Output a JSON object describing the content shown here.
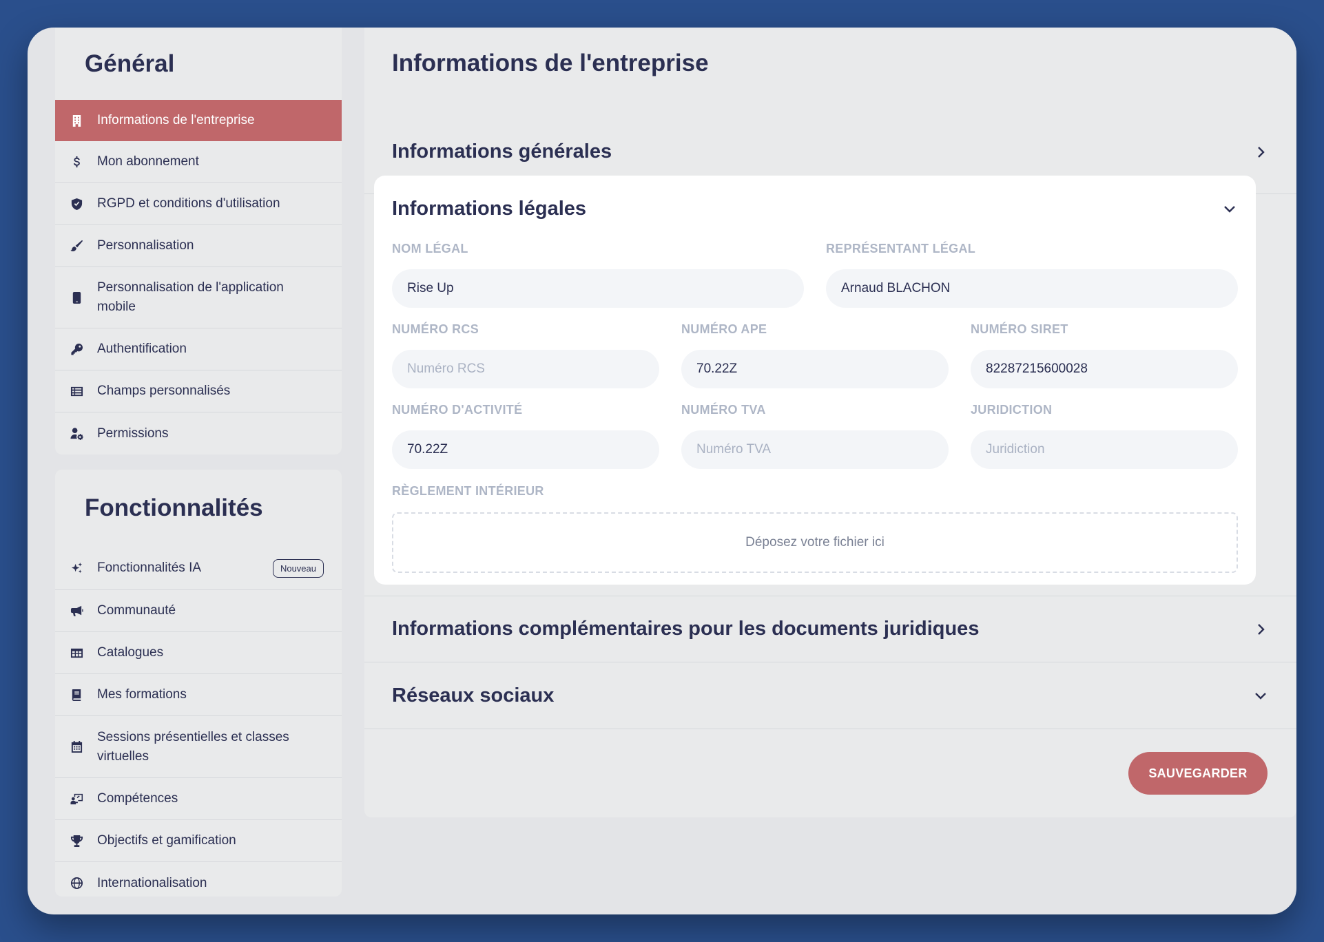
{
  "sidebar": {
    "general": {
      "title": "Général",
      "items": [
        {
          "label": "Informations de l'entreprise",
          "icon": "building-icon"
        },
        {
          "label": "Mon abonnement",
          "icon": "dollar-icon"
        },
        {
          "label": "RGPD et conditions d'utilisation",
          "icon": "shield-icon"
        },
        {
          "label": "Personnalisation",
          "icon": "brush-icon"
        },
        {
          "label": "Personnalisation de l'application mobile",
          "icon": "mobile-icon"
        },
        {
          "label": "Authentification",
          "icon": "key-icon"
        },
        {
          "label": "Champs personnalisés",
          "icon": "list-table-icon"
        },
        {
          "label": "Permissions",
          "icon": "user-gear-icon"
        }
      ]
    },
    "features": {
      "title": "Fonctionnalités",
      "items": [
        {
          "label": "Fonctionnalités IA",
          "icon": "sparkles-icon",
          "badge": "Nouveau"
        },
        {
          "label": "Communauté",
          "icon": "megaphone-icon"
        },
        {
          "label": "Catalogues",
          "icon": "grid-table-icon"
        },
        {
          "label": "Mes formations",
          "icon": "book-icon"
        },
        {
          "label": "Sessions présentielles et classes virtuelles",
          "icon": "calendar-icon"
        },
        {
          "label": "Compétences",
          "icon": "chalkboard-user-icon"
        },
        {
          "label": "Objectifs et gamification",
          "icon": "trophy-icon"
        },
        {
          "label": "Internationalisation",
          "icon": "globe-icon"
        }
      ]
    }
  },
  "main": {
    "title": "Informations de l'entreprise",
    "sections": {
      "general": "Informations générales",
      "legal": "Informations légales",
      "complementary": "Informations complémentaires pour les documents juridiques",
      "social": "Réseaux sociaux"
    },
    "legal_form": {
      "nom_legal": {
        "label": "NOM LÉGAL",
        "value": "Rise Up",
        "placeholder": "Nom légal"
      },
      "representant": {
        "label": "REPRÉSENTANT LÉGAL",
        "value": "Arnaud BLACHON",
        "placeholder": "Représentant légal"
      },
      "rcs": {
        "label": "NUMÉRO RCS",
        "value": "",
        "placeholder": "Numéro RCS"
      },
      "ape": {
        "label": "NUMÉRO APE",
        "value": "70.22Z",
        "placeholder": "Numéro APE"
      },
      "siret": {
        "label": "NUMÉRO SIRET",
        "value": "82287215600028",
        "placeholder": "Numéro SIRET"
      },
      "activite": {
        "label": "NUMÉRO D'ACTIVITÉ",
        "value": "70.22Z",
        "placeholder": "Numéro d'activité"
      },
      "tva": {
        "label": "NUMÉRO TVA",
        "value": "",
        "placeholder": "Numéro TVA"
      },
      "juridiction": {
        "label": "JURIDICTION",
        "value": "",
        "placeholder": "Juridiction"
      },
      "reglement": {
        "label": "RÈGLEMENT INTÉRIEUR",
        "dropzone_text": "Déposez votre fichier ici"
      }
    },
    "save_label": "SAUVEGARDER"
  },
  "colors": {
    "background": "#2a4f8c",
    "accent": "#c0676a",
    "text": "#2b2f52",
    "label": "#aeb6c6"
  }
}
